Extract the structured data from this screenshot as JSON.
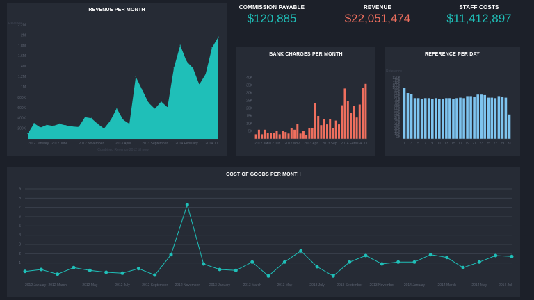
{
  "colors": {
    "teal": "#1fbfb8",
    "salmon": "#ef6f5e",
    "blue": "#7ec4ef",
    "bg": "#1c2029",
    "panel": "#262b35",
    "grid": "#3a404c"
  },
  "kpis": [
    {
      "label": "COMMISSION PAYABLE",
      "value": "$120,885",
      "color": "#1fbfb8"
    },
    {
      "label": "REVENUE",
      "value": "$22,051,474",
      "color": "#ef6f5e"
    },
    {
      "label": "STAFF COSTS",
      "value": "$11,412,897",
      "color": "#1fbfb8"
    }
  ],
  "chart_data": [
    {
      "type": "area",
      "title": "REVENUE PER MONTH",
      "ylabel": "Revenue",
      "ylim": [
        0,
        2200000
      ],
      "yticks": [
        "200K",
        "400K",
        "600K",
        "800K",
        "1M",
        "1.2M",
        "1.4M",
        "1.6M",
        "1.8M",
        "2M",
        "2.2M"
      ],
      "xticks": [
        "2012 January",
        "2012 June",
        "2012 November",
        "2013 April",
        "2013 September",
        "2014 February",
        "2014 Jul"
      ],
      "footnote": "Combined Revenue 2012 till now",
      "values": [
        100000,
        300000,
        220000,
        270000,
        250000,
        290000,
        260000,
        240000,
        230000,
        420000,
        400000,
        290000,
        200000,
        350000,
        590000,
        370000,
        290000,
        1200000,
        950000,
        700000,
        580000,
        720000,
        610000,
        1370000,
        1810000,
        1500000,
        1370000,
        1050000,
        1250000,
        1760000,
        1970000
      ]
    },
    {
      "type": "bar",
      "title": "BANK CHARGES PER MONTH",
      "ylim": [
        0,
        40000
      ],
      "yticks": [
        "5K",
        "10K",
        "15K",
        "20K",
        "25K",
        "30K",
        "35K",
        "40K"
      ],
      "xticks": [
        "2012 Jan",
        "2012 Jun",
        "2012 Nov",
        "2013 Apr",
        "2013 Sep",
        "2014 Feb",
        "2014 Jul"
      ],
      "values": [
        3000,
        6000,
        3000,
        6000,
        4000,
        4000,
        4000,
        5000,
        3000,
        5000,
        4500,
        3500,
        7000,
        6000,
        10000,
        3500,
        5000,
        2500,
        7000,
        7000,
        23500,
        15000,
        9000,
        13000,
        9500,
        13000,
        7000,
        12000,
        9500,
        22000,
        33000,
        25000,
        17000,
        21500,
        14000,
        22500,
        33500,
        36000
      ]
    },
    {
      "type": "bar",
      "title": "REFERENCE PER DAY",
      "ylabel": "Reference",
      "ylim": [
        0,
        120000
      ],
      "yticks": [
        "5K",
        "10K",
        "15K",
        "20K",
        "25K",
        "30K",
        "35K",
        "40K",
        "45K",
        "50K",
        "55K",
        "60K",
        "65K",
        "70K",
        "75K",
        "80K",
        "85K",
        "90K",
        "95K",
        "100K",
        "105K",
        "110K",
        "115K",
        "120K"
      ],
      "xticks": [
        "1",
        "3",
        "5",
        "7",
        "9",
        "11",
        "13",
        "15",
        "17",
        "19",
        "21",
        "23",
        "25",
        "27",
        "29",
        "31"
      ],
      "values": [
        100000,
        90000,
        88000,
        80000,
        80000,
        79000,
        80000,
        80000,
        79000,
        80000,
        79000,
        78000,
        80000,
        80000,
        78000,
        80000,
        81000,
        80000,
        84000,
        84000,
        83000,
        87000,
        87000,
        86000,
        81000,
        81000,
        80000,
        84000,
        83000,
        81000,
        48000
      ]
    },
    {
      "type": "line",
      "title": "COST OF GOODS PER MONTH",
      "ylim": [
        0,
        9
      ],
      "yticks": [
        "1",
        "2",
        "3",
        "4",
        "5",
        "6",
        "7",
        "8",
        "9"
      ],
      "xticks": [
        "2012 January",
        "2012 March",
        "2012 May",
        "2012 July",
        "2012 September",
        "2012 November",
        "2013 January",
        "2013 March",
        "2013 May",
        "2013 July",
        "2013 September",
        "2013 November",
        "2014 January",
        "2014 March",
        "2014 May",
        "2014 Jul"
      ],
      "values": [
        0.1,
        0.3,
        -0.2,
        0.5,
        0.2,
        0.0,
        -0.1,
        0.4,
        -0.3,
        1.9,
        7.3,
        0.9,
        0.3,
        0.2,
        1.1,
        -0.4,
        1.1,
        2.3,
        0.6,
        -0.4,
        1.1,
        1.8,
        0.9,
        1.1,
        1.1,
        1.9,
        1.6,
        0.5,
        1.1,
        1.8,
        1.7
      ]
    }
  ]
}
